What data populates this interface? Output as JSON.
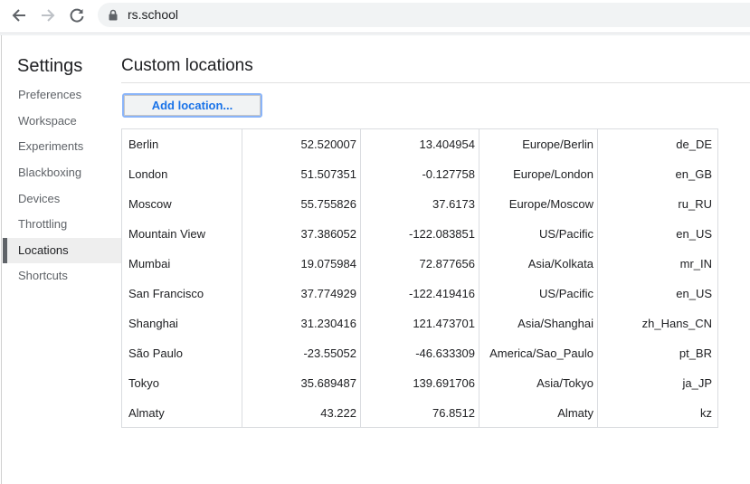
{
  "browser": {
    "url": "rs.school"
  },
  "sidebar": {
    "title": "Settings",
    "items": [
      {
        "label": "Preferences",
        "selected": false
      },
      {
        "label": "Workspace",
        "selected": false
      },
      {
        "label": "Experiments",
        "selected": false
      },
      {
        "label": "Blackboxing",
        "selected": false
      },
      {
        "label": "Devices",
        "selected": false
      },
      {
        "label": "Throttling",
        "selected": false
      },
      {
        "label": "Locations",
        "selected": true
      },
      {
        "label": "Shortcuts",
        "selected": false
      }
    ]
  },
  "main": {
    "title": "Custom locations",
    "add_button_label": "Add location...",
    "locations": [
      {
        "name": "Berlin",
        "lat": "52.520007",
        "lon": "13.404954",
        "timezone": "Europe/Berlin",
        "locale": "de_DE"
      },
      {
        "name": "London",
        "lat": "51.507351",
        "lon": "-0.127758",
        "timezone": "Europe/London",
        "locale": "en_GB"
      },
      {
        "name": "Moscow",
        "lat": "55.755826",
        "lon": "37.6173",
        "timezone": "Europe/Moscow",
        "locale": "ru_RU"
      },
      {
        "name": "Mountain View",
        "lat": "37.386052",
        "lon": "-122.083851",
        "timezone": "US/Pacific",
        "locale": "en_US"
      },
      {
        "name": "Mumbai",
        "lat": "19.075984",
        "lon": "72.877656",
        "timezone": "Asia/Kolkata",
        "locale": "mr_IN"
      },
      {
        "name": "San Francisco",
        "lat": "37.774929",
        "lon": "-122.419416",
        "timezone": "US/Pacific",
        "locale": "en_US"
      },
      {
        "name": "Shanghai",
        "lat": "31.230416",
        "lon": "121.473701",
        "timezone": "Asia/Shanghai",
        "locale": "zh_Hans_CN"
      },
      {
        "name": "São Paulo",
        "lat": "-23.55052",
        "lon": "-46.633309",
        "timezone": "America/Sao_Paulo",
        "locale": "pt_BR"
      },
      {
        "name": "Tokyo",
        "lat": "35.689487",
        "lon": "139.691706",
        "timezone": "Asia/Tokyo",
        "locale": "ja_JP"
      },
      {
        "name": "Almaty",
        "lat": "43.222",
        "lon": "76.8512",
        "timezone": "Almaty",
        "locale": "kz"
      }
    ]
  },
  "icons": {
    "back": "arrow-left-icon",
    "forward": "arrow-right-icon",
    "reload": "reload-icon",
    "lock": "lock-icon"
  },
  "colors": {
    "accent": "#1a73e8",
    "focus_ring": "#8ab4f8",
    "selected_bg": "#eeeeee"
  }
}
